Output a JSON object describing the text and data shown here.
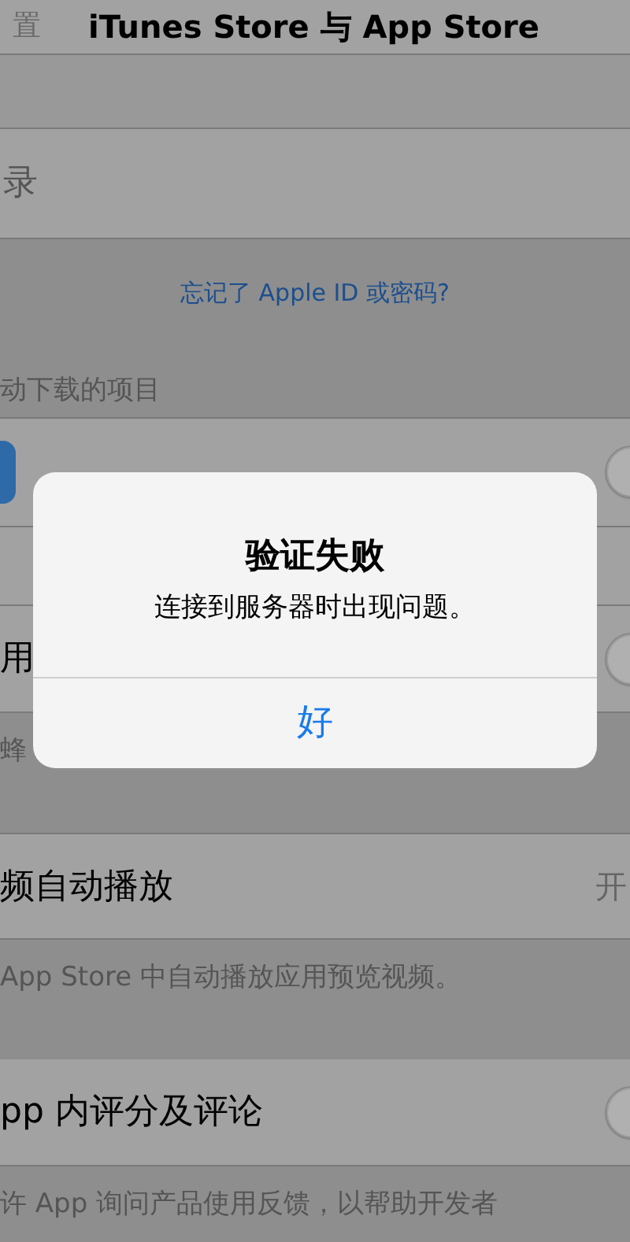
{
  "nav": {
    "back": "置",
    "title": "iTunes Store 与 App Store"
  },
  "sign_in": {
    "label": "录"
  },
  "forgot_link": "忘记了 Apple ID 或密码?",
  "section_header": "动下载的项目",
  "rows": [
    {
      "kind": "app",
      "on": false
    },
    {
      "kind": "blank"
    },
    {
      "kind": "toggle",
      "label": "用",
      "on": false
    },
    {
      "kind": "footer",
      "text": "蜂"
    },
    {
      "kind": "value",
      "label": "频自动播放",
      "value": "开"
    },
    {
      "kind": "footer",
      "text": "App Store 中自动播放应用预览视频。"
    },
    {
      "kind": "toggle",
      "label": "pp 内评分及评论",
      "on": false
    },
    {
      "kind": "footer",
      "text": "许 App 询问产品使用反馈，以帮助开发者"
    }
  ],
  "alert": {
    "title": "验证失败",
    "message": "连接到服务器时出现问题。",
    "button": "好"
  }
}
